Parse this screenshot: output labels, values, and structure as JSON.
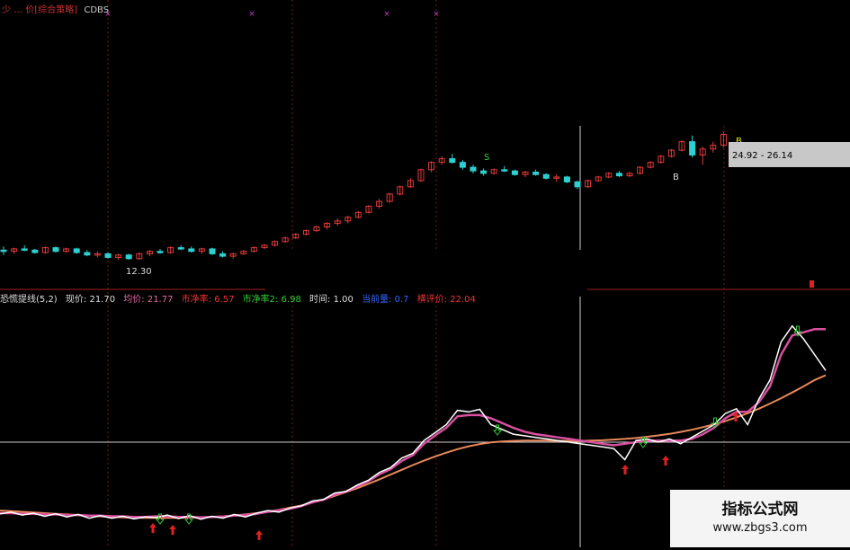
{
  "main_header": {
    "title": "少 … 价[综合策略]",
    "code": "CDBS"
  },
  "price_labels": {
    "low": "12.30",
    "range": "24.92 - 26.14",
    "s_mark": "S",
    "b_mark": "B",
    "marker_t": "T"
  },
  "indicator_header": {
    "name": "恐慌提线(5,2)",
    "items": [
      {
        "label": "现价: 21.70",
        "color": "#dddddd"
      },
      {
        "label": "均价: 21.77",
        "color": "#e06ca4"
      },
      {
        "label": "市净率: 6.57",
        "color": "#e33333"
      },
      {
        "label": "市净率2: 6.98",
        "color": "#33cc33"
      },
      {
        "label": "时间: 1.00",
        "color": "#dddddd"
      },
      {
        "label": "当前量: 0.7",
        "color": "#3366ff"
      },
      {
        "label": "横评价: 22.04",
        "color": "#e33333"
      }
    ]
  },
  "watermark": {
    "line1": "指标公式网",
    "line2": "www.zbgs3.com"
  },
  "colors": {
    "up": "#e03a3a",
    "down": "#2dd0d0",
    "white_line": "#ffffff",
    "pink_line": "#d84fa0",
    "orange_line": "#e8885a",
    "grid": "#7a1a1a"
  },
  "candles": [
    [
      17.6,
      17.9,
      17.2,
      17.5
    ],
    [
      17.5,
      17.8,
      17.3,
      17.7
    ],
    [
      17.7,
      18.0,
      17.5,
      17.6
    ],
    [
      17.6,
      17.7,
      17.3,
      17.4
    ],
    [
      17.4,
      17.9,
      17.3,
      17.8
    ],
    [
      17.8,
      17.9,
      17.4,
      17.5
    ],
    [
      17.5,
      17.8,
      17.4,
      17.7
    ],
    [
      17.7,
      17.8,
      17.3,
      17.4
    ],
    [
      17.4,
      17.6,
      17.1,
      17.2
    ],
    [
      17.2,
      17.5,
      17.0,
      17.3
    ],
    [
      17.3,
      17.4,
      16.9,
      17.0
    ],
    [
      17.0,
      17.3,
      16.8,
      17.2
    ],
    [
      17.2,
      17.3,
      16.8,
      16.9
    ],
    [
      16.9,
      17.4,
      16.8,
      17.3
    ],
    [
      17.3,
      17.6,
      17.1,
      17.5
    ],
    [
      17.5,
      17.7,
      17.3,
      17.4
    ],
    [
      17.4,
      17.9,
      17.3,
      17.8
    ],
    [
      17.8,
      18.0,
      17.6,
      17.7
    ],
    [
      17.7,
      17.9,
      17.4,
      17.5
    ],
    [
      17.5,
      17.8,
      17.3,
      17.7
    ],
    [
      17.7,
      17.8,
      17.2,
      17.3
    ],
    [
      17.3,
      17.5,
      17.0,
      17.1
    ],
    [
      17.1,
      17.4,
      16.9,
      17.3
    ],
    [
      17.3,
      17.6,
      17.2,
      17.5
    ],
    [
      17.5,
      17.9,
      17.4,
      17.8
    ],
    [
      17.8,
      18.1,
      17.7,
      18.0
    ],
    [
      18.0,
      18.4,
      17.9,
      18.3
    ],
    [
      18.3,
      18.7,
      18.2,
      18.6
    ],
    [
      18.6,
      19.0,
      18.5,
      18.9
    ],
    [
      18.9,
      19.3,
      18.8,
      19.2
    ],
    [
      19.2,
      19.6,
      19.1,
      19.5
    ],
    [
      19.5,
      19.9,
      19.3,
      19.8
    ],
    [
      19.8,
      20.2,
      19.6,
      20.0
    ],
    [
      20.0,
      20.4,
      19.8,
      20.3
    ],
    [
      20.3,
      20.8,
      20.2,
      20.7
    ],
    [
      20.7,
      21.3,
      20.6,
      21.2
    ],
    [
      21.2,
      21.8,
      21.0,
      21.6
    ],
    [
      21.6,
      22.3,
      21.5,
      22.2
    ],
    [
      22.2,
      22.9,
      22.1,
      22.8
    ],
    [
      22.8,
      23.5,
      22.7,
      23.3
    ],
    [
      23.3,
      24.3,
      23.2,
      24.2
    ],
    [
      24.2,
      24.9,
      24.0,
      24.8
    ],
    [
      24.8,
      25.3,
      24.6,
      25.1
    ],
    [
      25.1,
      25.5,
      24.7,
      24.8
    ],
    [
      24.8,
      25.0,
      24.2,
      24.4
    ],
    [
      24.4,
      24.6,
      23.9,
      24.1
    ],
    [
      24.1,
      24.3,
      23.7,
      23.9
    ],
    [
      23.9,
      24.3,
      23.8,
      24.2
    ],
    [
      24.2,
      24.5,
      24.0,
      24.1
    ],
    [
      24.1,
      24.2,
      23.7,
      23.8
    ],
    [
      23.8,
      24.1,
      23.6,
      24.0
    ],
    [
      24.0,
      24.2,
      23.7,
      23.8
    ],
    [
      23.8,
      23.9,
      23.4,
      23.5
    ],
    [
      23.5,
      23.8,
      23.2,
      23.6
    ],
    [
      23.6,
      23.7,
      23.1,
      23.2
    ],
    [
      23.2,
      23.3,
      22.6,
      22.8
    ],
    [
      22.8,
      23.4,
      22.7,
      23.3
    ],
    [
      23.3,
      23.7,
      23.2,
      23.6
    ],
    [
      23.6,
      24.0,
      23.5,
      23.9
    ],
    [
      23.9,
      24.1,
      23.6,
      23.7
    ],
    [
      23.7,
      24.0,
      23.6,
      23.9
    ],
    [
      23.9,
      24.5,
      23.8,
      24.4
    ],
    [
      24.4,
      24.9,
      24.3,
      24.8
    ],
    [
      24.8,
      25.4,
      24.7,
      25.3
    ],
    [
      25.3,
      25.9,
      25.2,
      25.8
    ],
    [
      25.8,
      26.6,
      25.7,
      26.5
    ],
    [
      26.5,
      27.0,
      25.2,
      25.4
    ],
    [
      25.4,
      26.1,
      24.6,
      25.9
    ],
    [
      25.9,
      26.5,
      25.6,
      26.2
    ],
    [
      26.2,
      27.3,
      26.0,
      27.1
    ]
  ],
  "ind_white": [
    8,
    8.5,
    7.6,
    8.2,
    7.2,
    8.0,
    7.0,
    7.8,
    6.6,
    7.4,
    6.6,
    7.2,
    6.4,
    7.0,
    6.8,
    7.6,
    6.5,
    7.4,
    6.3,
    7.2,
    6.6,
    7.8,
    7.0,
    8.2,
    9.0,
    8.5,
    9.8,
    10.5,
    12.0,
    12.5,
    14.5,
    15.0,
    17.0,
    18.5,
    21.0,
    22.5,
    25.5,
    27.0,
    31.0,
    33.5,
    36.0,
    40.5,
    40.0,
    40.8,
    36.0,
    34.5,
    33.0,
    32.5,
    32.0,
    31.5,
    31.0,
    30.5,
    30.0,
    29.5,
    29.0,
    28.5,
    25.0,
    31.0,
    31.5,
    30.5,
    31.5,
    30.0,
    32.0,
    34.0,
    36.0,
    39.5,
    41.0,
    36.0,
    44.0,
    50.0,
    62.0,
    67.0,
    63.0,
    58.0,
    53.0
  ],
  "ind_pink": [
    8.2,
    8.2,
    8.0,
    8.0,
    7.8,
    7.8,
    7.6,
    7.6,
    7.4,
    7.4,
    7.2,
    7.2,
    7.0,
    7.0,
    7.2,
    7.2,
    7.0,
    7.0,
    6.9,
    7.0,
    7.1,
    7.4,
    7.6,
    8.0,
    8.6,
    9.0,
    9.6,
    10.4,
    11.6,
    12.4,
    14.0,
    15.0,
    16.6,
    18.2,
    20.4,
    22.0,
    24.6,
    26.4,
    30.0,
    32.6,
    35.0,
    38.6,
    39.0,
    39.0,
    38.0,
    36.5,
    35.0,
    33.8,
    33.0,
    32.5,
    32.0,
    31.5,
    31.0,
    30.5,
    30.0,
    29.5,
    30.0,
    30.5,
    31.0,
    31.0,
    31.0,
    31.0,
    31.5,
    33.0,
    35.0,
    38.0,
    40.0,
    40.0,
    43.0,
    48.0,
    58.0,
    64.0,
    65.0,
    66.0,
    66.0
  ],
  "ind_orange": [
    9.0,
    8.8,
    8.6,
    8.4,
    8.2,
    8.0,
    7.8,
    7.6,
    7.4,
    7.2,
    7.0,
    6.9,
    6.8,
    6.7,
    6.7,
    6.7,
    6.7,
    6.8,
    6.9,
    7.0,
    7.2,
    7.5,
    7.8,
    8.2,
    8.7,
    9.2,
    9.9,
    10.6,
    11.5,
    12.5,
    13.6,
    14.8,
    16.0,
    17.4,
    18.8,
    20.3,
    21.8,
    23.3,
    24.7,
    26.0,
    27.2,
    28.3,
    29.2,
    29.9,
    30.4,
    30.7,
    30.9,
    31.0,
    31.0,
    31.0,
    30.9,
    30.9,
    30.9,
    31.0,
    31.1,
    31.3,
    31.5,
    31.8,
    32.2,
    32.6,
    33.1,
    33.7,
    34.4,
    35.2,
    36.1,
    37.1,
    38.3,
    39.6,
    41.0,
    42.6,
    44.3,
    46.1,
    48.0,
    50.0,
    51.5
  ]
}
